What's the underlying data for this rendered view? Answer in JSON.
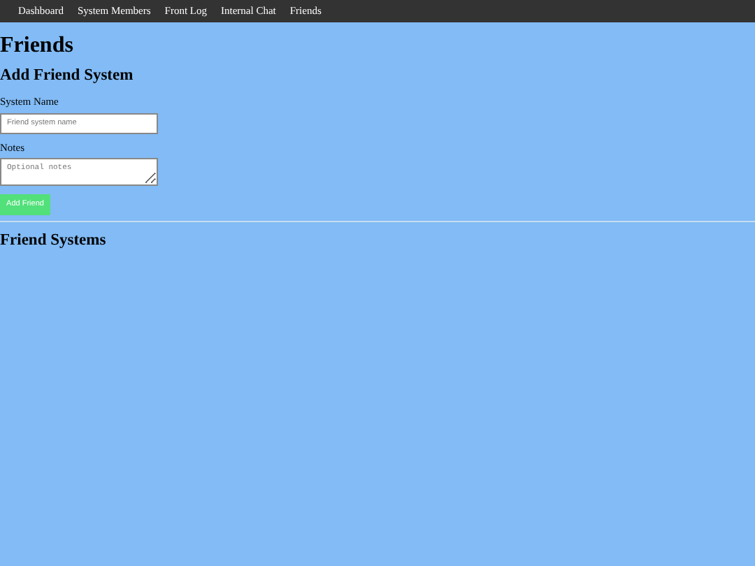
{
  "nav": [
    {
      "label": "Dashboard"
    },
    {
      "label": "System Members"
    },
    {
      "label": "Front Log"
    },
    {
      "label": "Internal Chat"
    },
    {
      "label": "Friends"
    }
  ],
  "title": "Friends",
  "form": {
    "heading": "Add Friend System",
    "fields": [
      {
        "kind": "text",
        "label": "System Name",
        "placeholder": "Friend system name"
      },
      {
        "kind": "textarea",
        "label": "Notes",
        "placeholder": "Optional notes"
      }
    ],
    "button": "Add Friend"
  },
  "list_heading": "Friend Systems"
}
